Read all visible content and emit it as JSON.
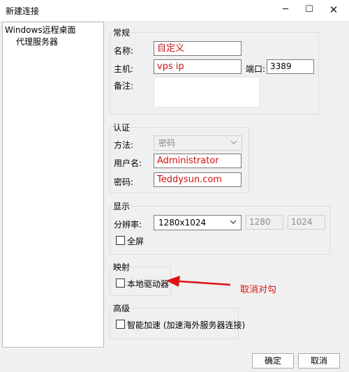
{
  "window": {
    "title": "新建连接",
    "min_glyph": "─",
    "max_glyph": "☐",
    "close_glyph": "✕"
  },
  "tree": {
    "root": "Windows远程桌面",
    "child": "代理服务器"
  },
  "general": {
    "legend": "常规",
    "name_label": "名称:",
    "name_value": "自定义",
    "host_label": "主机:",
    "host_value": "vps ip",
    "port_label": "端口:",
    "port_value": "3389",
    "note_label": "备注:",
    "note_value": ""
  },
  "auth": {
    "legend": "认证",
    "method_label": "方法:",
    "method_value": "密码",
    "user_label": "用户名:",
    "user_value": "Administrator",
    "pass_label": "密码:",
    "pass_value": "Teddysun.com"
  },
  "display": {
    "legend": "显示",
    "res_label": "分辨率:",
    "res_value": "1280x1024",
    "width_value": "1280",
    "height_value": "1024",
    "fullscreen_label": "全屏",
    "fullscreen_checked": false
  },
  "mapping": {
    "legend": "映射",
    "local_drive_label": "本地驱动器",
    "local_drive_checked": false
  },
  "advanced": {
    "legend": "高级",
    "smart_accel_label": "智能加速 (加速海外服务器连接)",
    "smart_accel_checked": false
  },
  "buttons": {
    "ok": "确定",
    "cancel": "取消"
  },
  "annotation": {
    "text": "取消对勾",
    "color": "#e01010"
  }
}
